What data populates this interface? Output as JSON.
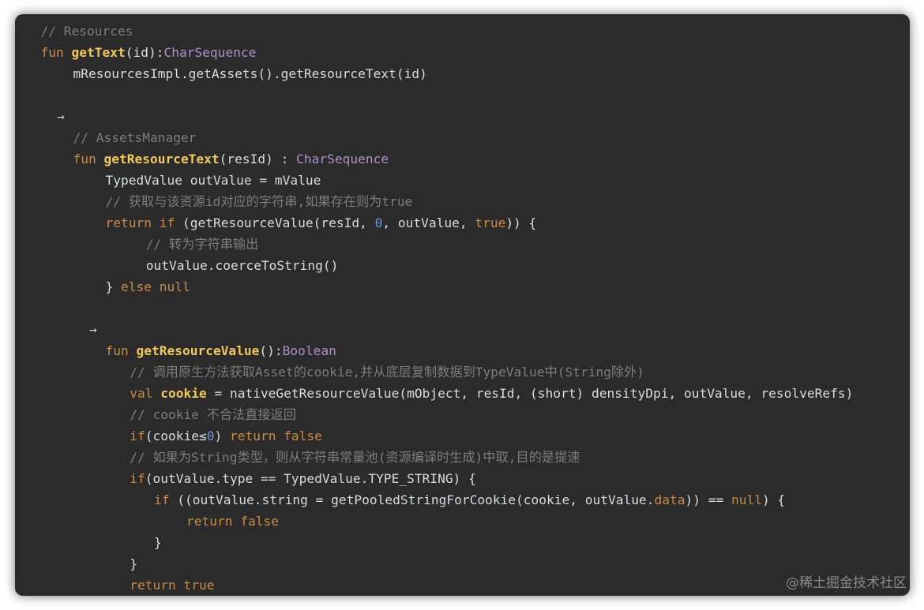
{
  "watermark": "@稀土掘金技术社区",
  "colors": {
    "background": "#2b2b2b",
    "plain": "#d8dbe0",
    "keyword": "#cc8a45",
    "function": "#f2c85c",
    "type": "#b08fc9",
    "comment": "#7d7d7d",
    "number": "#6b9bd0"
  },
  "code_lines": [
    {
      "indent": 2,
      "tokens": [
        [
          "// Resources",
          "comment"
        ]
      ]
    },
    {
      "indent": 2,
      "tokens": [
        [
          "fun ",
          "keyword"
        ],
        [
          "getText",
          "fn"
        ],
        [
          "(id):",
          "plain"
        ],
        [
          "CharSequence",
          "type"
        ]
      ]
    },
    {
      "indent": 6,
      "tokens": [
        [
          "mResourcesImpl.getAssets().getResourceText(id)",
          "plain"
        ]
      ]
    },
    {
      "indent": 0,
      "tokens": []
    },
    {
      "indent": 4,
      "tokens": [
        [
          "→",
          "arrow"
        ]
      ]
    },
    {
      "indent": 6,
      "tokens": [
        [
          "// AssetsManager",
          "comment"
        ]
      ]
    },
    {
      "indent": 6,
      "tokens": [
        [
          "fun ",
          "keyword"
        ],
        [
          "getResourceText",
          "fn"
        ],
        [
          "(resId) : ",
          "plain"
        ],
        [
          "CharSequence",
          "type"
        ]
      ]
    },
    {
      "indent": 10,
      "tokens": [
        [
          "TypedValue outValue = mValue",
          "plain"
        ]
      ]
    },
    {
      "indent": 10,
      "tokens": [
        [
          "// 获取与该资源id对应的字符串,如果存在则为true",
          "comment"
        ]
      ]
    },
    {
      "indent": 10,
      "tokens": [
        [
          "return if ",
          "keyword"
        ],
        [
          "(getResourceValue(resId, ",
          "plain"
        ],
        [
          "0",
          "number"
        ],
        [
          ", outValue, ",
          "plain"
        ],
        [
          "true",
          "keyword"
        ],
        [
          ")) {",
          "plain"
        ]
      ]
    },
    {
      "indent": 15,
      "tokens": [
        [
          "// 转为字符串输出",
          "comment"
        ]
      ]
    },
    {
      "indent": 15,
      "tokens": [
        [
          "outValue.coerceToString()",
          "plain"
        ]
      ]
    },
    {
      "indent": 10,
      "tokens": [
        [
          "} ",
          "plain"
        ],
        [
          "else null",
          "keyword"
        ]
      ]
    },
    {
      "indent": 0,
      "tokens": []
    },
    {
      "indent": 8,
      "tokens": [
        [
          "→",
          "arrow"
        ]
      ]
    },
    {
      "indent": 10,
      "tokens": [
        [
          "fun ",
          "keyword"
        ],
        [
          "getResourceValue",
          "fn"
        ],
        [
          "():",
          "plain"
        ],
        [
          "Boolean",
          "type"
        ]
      ]
    },
    {
      "indent": 13,
      "tokens": [
        [
          "// 调用原生方法获取Asset的cookie,并从底层复制数据到TypeValue中(String除外)",
          "comment"
        ]
      ]
    },
    {
      "indent": 13,
      "tokens": [
        [
          "val ",
          "keyword"
        ],
        [
          "cookie",
          "fn"
        ],
        [
          " = nativeGetResourceValue(mObject, resId, (short) densityDpi, outValue, resolveRefs)",
          "plain"
        ]
      ]
    },
    {
      "indent": 13,
      "tokens": [
        [
          "// cookie 不合法直接返回",
          "comment"
        ]
      ]
    },
    {
      "indent": 13,
      "tokens": [
        [
          "if",
          "keyword"
        ],
        [
          "(cookie≤",
          "plain"
        ],
        [
          "0",
          "number"
        ],
        [
          ") ",
          "plain"
        ],
        [
          "return false",
          "keyword"
        ]
      ]
    },
    {
      "indent": 13,
      "tokens": [
        [
          "// 如果为String类型，则从字符串常量池(资源编译时生成)中取,目的是提速",
          "comment"
        ]
      ]
    },
    {
      "indent": 13,
      "tokens": [
        [
          "if",
          "keyword"
        ],
        [
          "(outValue.type == TypedValue.TYPE_STRING) {",
          "plain"
        ]
      ]
    },
    {
      "indent": 16,
      "tokens": [
        [
          "if ",
          "keyword"
        ],
        [
          "((outValue.string = getPooledStringForCookie(cookie, outValue.",
          "plain"
        ],
        [
          "data",
          "prop"
        ],
        [
          ")) == ",
          "plain"
        ],
        [
          "null",
          "keyword"
        ],
        [
          ") {",
          "plain"
        ]
      ]
    },
    {
      "indent": 20,
      "tokens": [
        [
          "return false",
          "keyword"
        ]
      ]
    },
    {
      "indent": 16,
      "tokens": [
        [
          "}",
          "plain"
        ]
      ]
    },
    {
      "indent": 13,
      "tokens": [
        [
          "}",
          "plain"
        ]
      ]
    },
    {
      "indent": 13,
      "tokens": [
        [
          "return true",
          "keyword"
        ]
      ]
    }
  ]
}
